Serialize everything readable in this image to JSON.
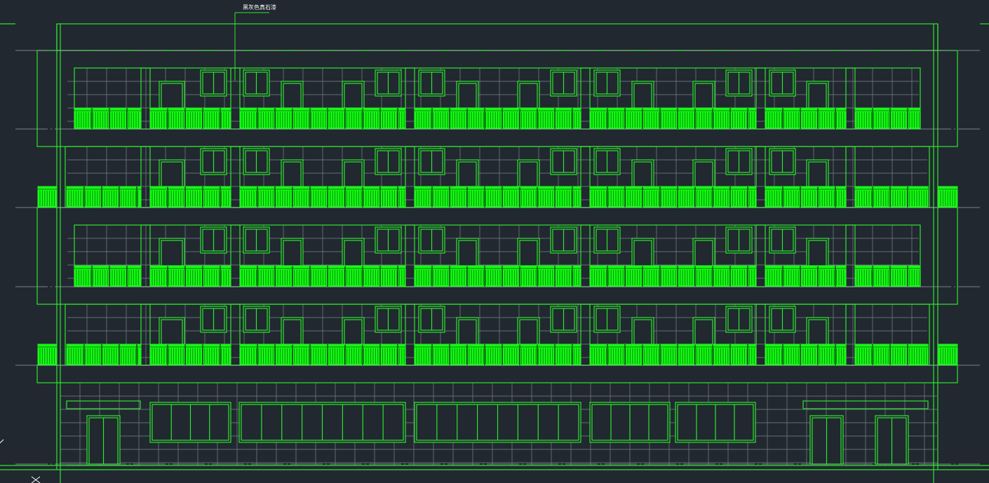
{
  "drawing": {
    "annotation": "黑灰色真石漆",
    "colors": {
      "background": "#212830",
      "outline": "#2ee62e",
      "railing_fill": "#11ff11",
      "railing_bars": "#0b7a0b",
      "tile_grid": "#7b828a",
      "center_line": "#9aa0a6",
      "annotation_text": "#ffffff"
    },
    "icons": {
      "ucs_marker": "x-cross-icon"
    }
  }
}
